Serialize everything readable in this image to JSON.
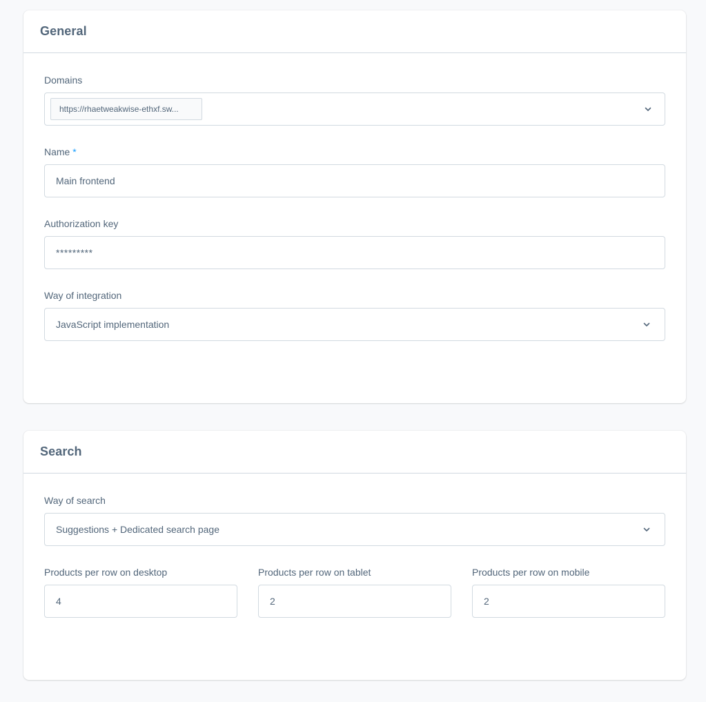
{
  "general": {
    "title": "General",
    "domains": {
      "label": "Domains",
      "selected": [
        "https://rhaetweakwise-ethxf.sw..."
      ]
    },
    "name": {
      "label": "Name",
      "required_marker": "*",
      "value": "Main frontend"
    },
    "authorization_key": {
      "label": "Authorization key",
      "value": "*********"
    },
    "way_of_integration": {
      "label": "Way of integration",
      "value": "JavaScript implementation"
    }
  },
  "search": {
    "title": "Search",
    "way_of_search": {
      "label": "Way of search",
      "value": "Suggestions + Dedicated search page"
    },
    "products_desktop": {
      "label": "Products per row on desktop",
      "value": "4"
    },
    "products_tablet": {
      "label": "Products per row on tablet",
      "value": "2"
    },
    "products_mobile": {
      "label": "Products per row on mobile",
      "value": "2"
    }
  },
  "colors": {
    "text": "#52667a",
    "border": "#d1d9e0",
    "required": "#189eff",
    "background": "#f8f9fb"
  },
  "icons": {
    "select_chevron": "chevron-down-icon"
  }
}
